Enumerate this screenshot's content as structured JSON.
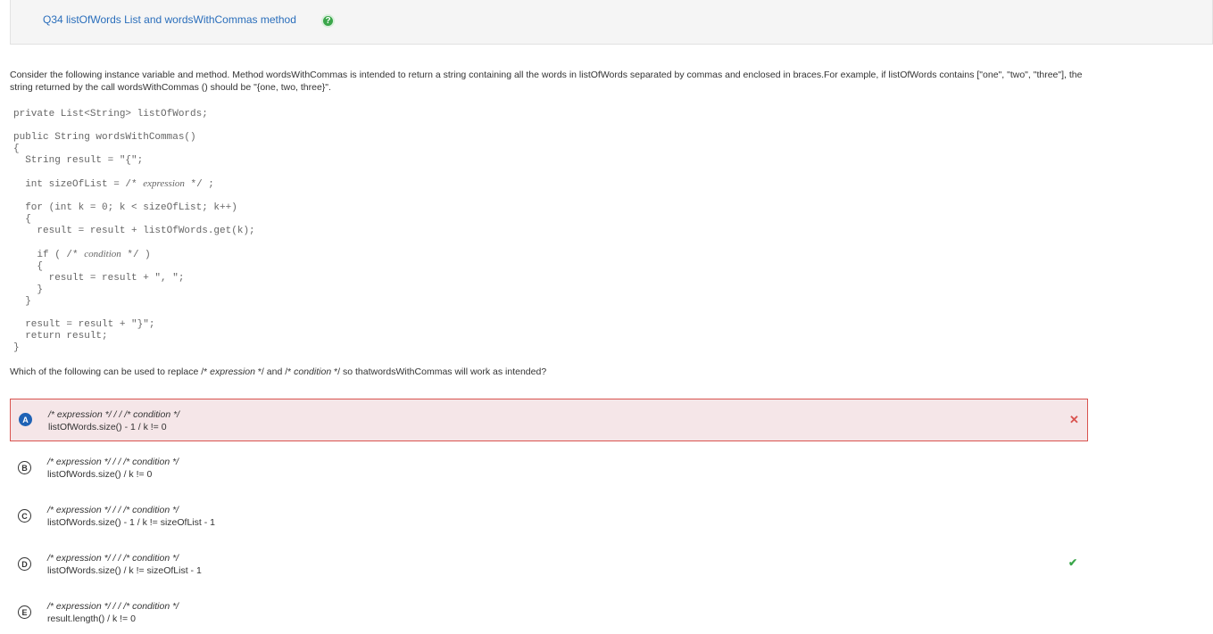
{
  "header": {
    "title": "Q34 listOfWords List and wordsWithCommas method",
    "help_icon": "?"
  },
  "prompt": {
    "text": "Consider the following instance variable and method. Method wordsWithCommas is intended to return a string containing all the words in listOfWords separated by commas and enclosed in braces.For example, if listOfWords contains [\"one\", \"two\", \"three\"], the string returned by the call wordsWithCommas () should be \"{one, two, three}\"."
  },
  "code": {
    "line1": "private List<String> listOfWords;",
    "line2": "public String wordsWithCommas()",
    "line3": "{",
    "line4": "  String result = \"{\";",
    "line5a": "  int sizeOfList = /* ",
    "line5b": "expression",
    "line5c": " */ ;",
    "line6": "  for (int k = 0; k < sizeOfList; k++)",
    "line7": "  {",
    "line8": "    result = result + listOfWords.get(k);",
    "line9a": "    if ( /* ",
    "line9b": "condition",
    "line9c": " */ )",
    "line10": "    {",
    "line11": "      result = result + \", \";",
    "line12": "    }",
    "line13": "  }",
    "line14": "  result = result + \"}\";",
    "line15": "  return result;",
    "line16": "}"
  },
  "question": {
    "p1": "Which of the following can be used to replace /* ",
    "p2": "expression",
    "p3": " */ and /* ",
    "p4": "condition",
    "p5": " */ so thatwordsWithCommas will work as intended?"
  },
  "choices": [
    {
      "letter": "A",
      "line1": "/* expression */ / / /* condition */",
      "line2": "listOfWords.size() - 1 / k != 0",
      "state": "selected-wrong",
      "mark": "✕"
    },
    {
      "letter": "B",
      "line1": "/* expression */ / / /* condition */",
      "line2": "listOfWords.size() / k != 0",
      "state": "",
      "mark": ""
    },
    {
      "letter": "C",
      "line1": "/* expression */ / / /* condition */",
      "line2": "listOfWords.size() - 1 / k != sizeOfList - 1",
      "state": "",
      "mark": ""
    },
    {
      "letter": "D",
      "line1": "/* expression */ / / /* condition */",
      "line2": "listOfWords.size() / k != sizeOfList - 1",
      "state": "correct",
      "mark": "✔"
    },
    {
      "letter": "E",
      "line1": "/* expression */ / / /* condition */",
      "line2": "result.length() / k != 0",
      "state": "",
      "mark": ""
    }
  ],
  "colors": {
    "title_blue": "#2a6ebb",
    "wrong_red": "#d9534f",
    "wrong_bg": "#f5e6e8",
    "correct_green": "#3aa64a",
    "selected_blue": "#1f62b5"
  },
  "icons": {
    "help": "help-icon",
    "wrong": "x-icon",
    "correct": "check-icon"
  }
}
